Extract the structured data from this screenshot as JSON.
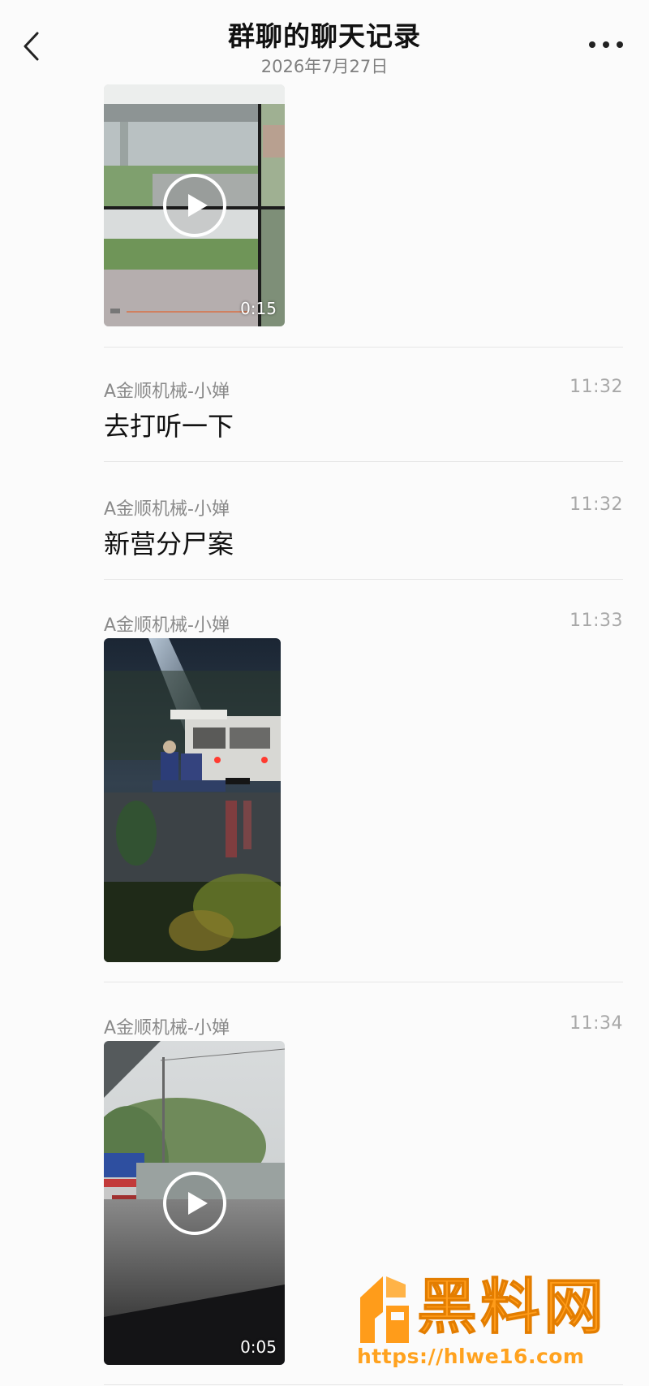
{
  "header": {
    "title": "群聊的聊天记录",
    "date": "2026年7月27日",
    "back_icon": "chevron-left-icon",
    "more_icon": "more-dots-icon"
  },
  "messages": [
    {
      "type": "video",
      "duration": "0:15"
    },
    {
      "type": "text",
      "sender": "A金顺机械-小婵",
      "time": "11:32",
      "text": "去打听一下"
    },
    {
      "type": "text",
      "sender": "A金顺机械-小婵",
      "time": "11:32",
      "text": "新营分尸案"
    },
    {
      "type": "image",
      "sender": "A金顺机械-小婵",
      "time": "11:33"
    },
    {
      "type": "video",
      "sender": "A金顺机械-小婵",
      "time": "11:34",
      "duration": "0:05"
    }
  ],
  "watermark": {
    "brand": "黑料网",
    "url": "https://hlwe16.com",
    "color": "#ff9c1a"
  },
  "colors": {
    "background": "#fbfbfb",
    "divider": "#e6e6e6",
    "sender_text": "#8a8a8a",
    "time_text": "#a8a8a8"
  }
}
